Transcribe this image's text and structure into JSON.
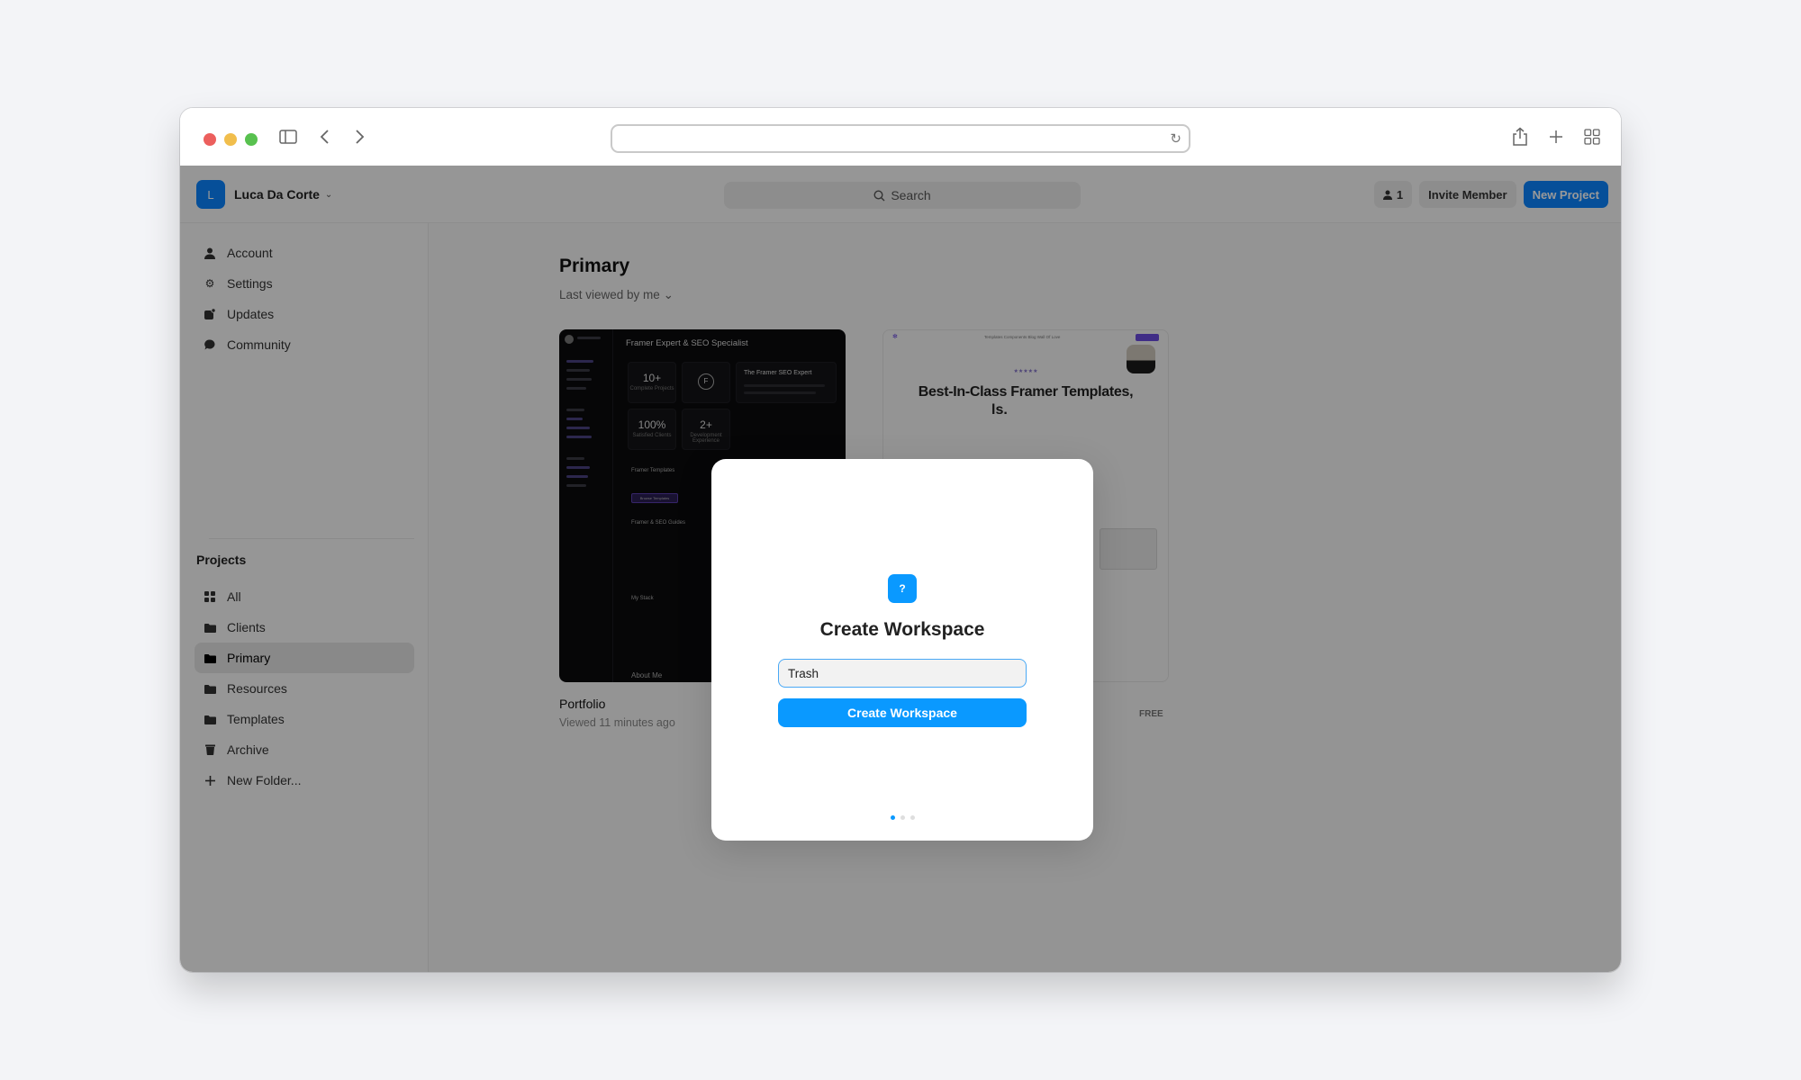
{
  "browser": {
    "address_value": "",
    "icons": [
      "sidebar-toggle-icon",
      "back-icon",
      "forward-icon",
      "reload-icon",
      "share-icon",
      "new-tab-icon",
      "tab-overview-icon"
    ]
  },
  "topbar": {
    "workspace_initial": "L",
    "workspace_name": "Luca Da Corte",
    "search_placeholder": "Search",
    "member_count": "1",
    "invite_label": "Invite Member",
    "new_project_label": "New Project"
  },
  "sidebar": {
    "account_items": [
      {
        "label": "Account",
        "icon": "person-icon"
      },
      {
        "label": "Settings",
        "icon": "gear-icon"
      },
      {
        "label": "Updates",
        "icon": "updates-icon"
      },
      {
        "label": "Community",
        "icon": "chat-bubble-icon"
      }
    ],
    "projects_heading": "Projects",
    "project_items": [
      {
        "label": "All",
        "icon": "grid-icon"
      },
      {
        "label": "Clients",
        "icon": "folder-icon"
      },
      {
        "label": "Primary",
        "icon": "folder-icon",
        "active": true
      },
      {
        "label": "Resources",
        "icon": "folder-icon"
      },
      {
        "label": "Templates",
        "icon": "folder-icon"
      },
      {
        "label": "Archive",
        "icon": "trash-icon"
      },
      {
        "label": "New Folder...",
        "icon": "plus-icon"
      }
    ]
  },
  "main": {
    "title": "Primary",
    "sort_label": "Last viewed by me",
    "projects": [
      {
        "name": "Portfolio",
        "subtitle": "Viewed 11 minutes ago",
        "thumbnail": {
          "heading": "Framer Expert & SEO Specialist",
          "stats": [
            {
              "value": "10+",
              "label": "Complete Projects"
            },
            {
              "value": "100%",
              "label": "Satisfied Clients"
            },
            {
              "value": "2+",
              "label": "Development Experience"
            }
          ],
          "expert_title": "The Framer SEO Expert",
          "sections": [
            "Framer Templates",
            "Framer & SEO Guides",
            "My Stack",
            "About Me"
          ],
          "browse_button": "Browse Templates"
        }
      },
      {
        "name": "",
        "subtitle": "",
        "badge": "FREE",
        "thumbnail": {
          "nav": "Templates  Components  Blog  Wall Of Love",
          "stars": "★★★★★",
          "headline_line1": "Best-In-Class Framer Templates,",
          "headline_line2": "ls."
        }
      }
    ]
  },
  "modal": {
    "icon_glyph": "?",
    "title": "Create Workspace",
    "input_value": "Trash",
    "submit_label": "Create Workspace",
    "pagination": {
      "total": 3,
      "current": 1
    }
  },
  "colors": {
    "accent": "#0a99ff",
    "brand_blue": "#0a84ff"
  }
}
